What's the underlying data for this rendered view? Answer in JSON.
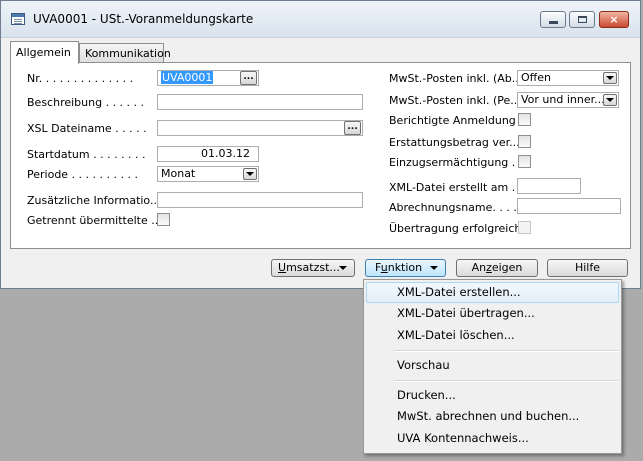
{
  "window": {
    "title": "UVA0001 - USt.-Voranmeldungskarte",
    "app_icon": "form-icon",
    "controls": {
      "minimize": "minimize-icon",
      "maximize": "maximize-icon",
      "close": "×"
    }
  },
  "tabs": [
    {
      "label": "Allgemein",
      "active": true
    },
    {
      "label": "Kommunikation",
      "active": false
    }
  ],
  "left_fields": {
    "nr": {
      "label": "Nr. . . . . . . . . . . . . .",
      "value": "UVA0001",
      "lookup": "..."
    },
    "beschreibung": {
      "label": "Beschreibung . . . . . .",
      "value": ""
    },
    "xsl_dateiname": {
      "label": "XSL Dateiname . . . . .",
      "value": "",
      "lookup": "..."
    },
    "startdatum": {
      "label": "Startdatum . . . . . . . .",
      "value": "01.03.12"
    },
    "periode": {
      "label": "Periode . . . . . . . . . .",
      "value": "Monat"
    },
    "zusaetzliche": {
      "label": "Zusätzliche Informatio...",
      "value": ""
    },
    "getrennt": {
      "label": "Getrennt übermittelte ...",
      "checked": false
    }
  },
  "right_fields": {
    "mwst_ab": {
      "label": "MwSt.-Posten inkl. (Ab...",
      "value": "Offen"
    },
    "mwst_pe": {
      "label": "MwSt.-Posten inkl. (Pe...",
      "value": "Vor und inner..."
    },
    "berichtigte": {
      "label": "Berichtigte Anmeldung . .",
      "checked": false
    },
    "erstattung": {
      "label": "Erstattungsbetrag ver...",
      "checked": false
    },
    "einzug": {
      "label": "Einzugsermächtigung . .",
      "checked": false
    },
    "xml_erstellt": {
      "label": "XML-Datei erstellt am . .",
      "value": ""
    },
    "abrechnungsname": {
      "label": "Abrechnungsname. . . .",
      "value": ""
    },
    "uebertragung": {
      "label": "Übertragung erfolgreich .",
      "checked": false
    }
  },
  "buttons": {
    "umsatzst": {
      "accel": "U",
      "rest": "msatzst..."
    },
    "funktion": {
      "pre": "F",
      "accel": "u",
      "rest": "nktion"
    },
    "anzeigen": {
      "pre": "An",
      "accel": "z",
      "rest": "eigen"
    },
    "hilfe": {
      "label": "Hilfe"
    }
  },
  "menu": {
    "items": [
      "XML-Datei erstellen...",
      "XML-Datei übertragen...",
      "XML-Datei löschen...",
      "Vorschau",
      "Drucken...",
      "MwSt. abrechnen und buchen...",
      "UVA Kontennachweis..."
    ]
  }
}
